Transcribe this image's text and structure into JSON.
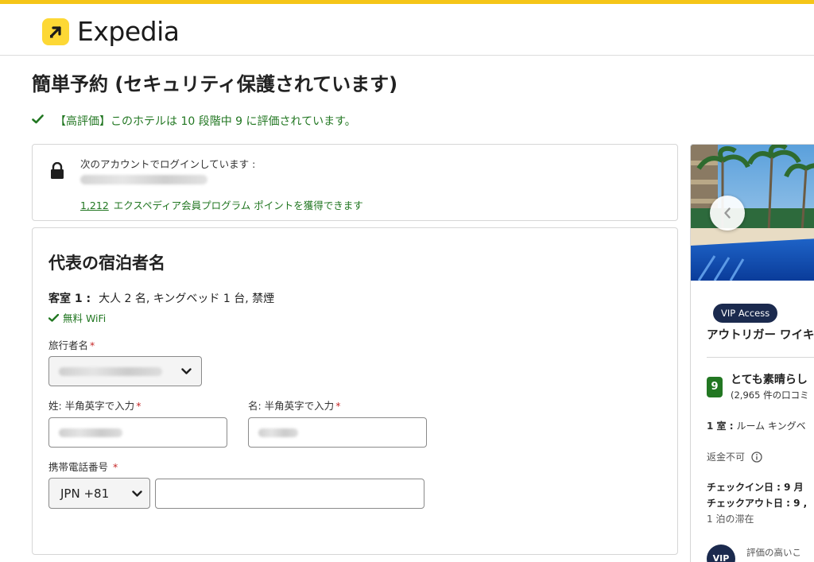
{
  "brand": {
    "name": "Expedia",
    "accent": "#f5c518",
    "logo_bg": "#fdd835"
  },
  "page": {
    "title": "簡単予約 (セキュリティ保護されています)",
    "rating_note": "【高評価】このホテルは 10 段階中 9 に評価されています。"
  },
  "login": {
    "label": "次のアカウントでログインしています :",
    "points_number": "1,212",
    "points_text": "エクスペディア会員プログラム ポイントを獲得できます"
  },
  "guest": {
    "title": "代表の宿泊者名",
    "room_label": "客室 1 :",
    "room_desc": "大人 2 名, キングベッド 1 台, 禁煙",
    "wifi": "無料 WiFi",
    "traveler_label": "旅行者名",
    "last_name_label": "姓: 半角英字で入力",
    "first_name_label": "名: 半角英字で入力",
    "phone_label": "携帯電話番号",
    "country_code": "JPN +81",
    "required_mark": "*"
  },
  "sidebar": {
    "vip_badge": "VIP Access",
    "hotel_name": "アウトリガー ワイキ",
    "score": "9",
    "score_word": "とても素晴らし",
    "review_count": "(2,965 件の口コミ",
    "room_label": "1 室 :",
    "room_type": "ルーム キングベ",
    "non_refundable": "返金不可",
    "checkin": "チェックイン日 : 9 月",
    "checkout": "チェックアウト日 : 9 ,",
    "nights": "1 泊の滞在",
    "vip_circle": "VIP",
    "vip_note": "評価の高いこ"
  },
  "colors": {
    "success": "#227722",
    "required": "#c62828",
    "vip_navy": "#1b2a4e"
  }
}
